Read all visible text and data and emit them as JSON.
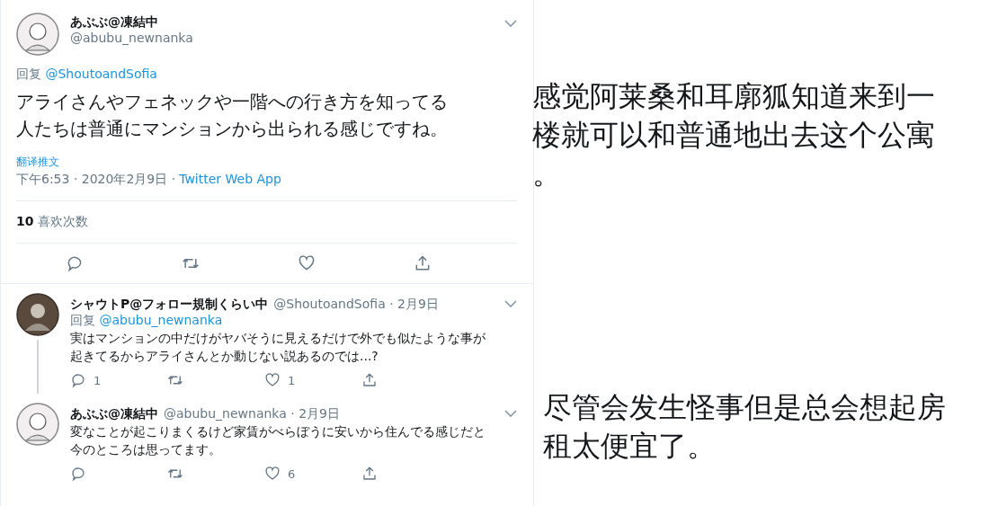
{
  "tweet": {
    "name": "あぶぶ@凍結中",
    "handle": "@abubu_newnanka",
    "reply_label": "回复",
    "reply_handle": "@ShoutoandSofia",
    "text": "アライさんやフェネックや一階への行き方を知ってる人たちは普通にマンションから出られる感じですね。",
    "translate": "翻译推文",
    "timestamp": "下午6:53 · 2020年2月9日 ·",
    "source": "Twitter Web App",
    "like_count": "10",
    "like_label": "喜欢次数"
  },
  "replies": [
    {
      "name": "シャウトP@フォロー規制くらい中",
      "meta": "@ShoutoandSofia · 2月9日",
      "reply_label": "回复",
      "reply_handle": "@abubu_newnanka",
      "text": "実はマンションの中だけがヤバそうに見えるだけで外でも似たような事が起きてるからアライさんとか動じない説あるのでは...?",
      "reply_count": "1",
      "like_count": "1",
      "thread_line": true
    },
    {
      "name": "あぶぶ@凍結中",
      "meta": "@abubu_newnanka · 2月9日",
      "text": "変なことが起こりまくるけど家賃がべらぼうに安いから住んでる感じだと今のところは思ってます。",
      "like_count": "6",
      "thread_line": false
    }
  ],
  "captions": [
    "感觉阿莱桑和耳廓狐知道来到一楼就可以和普通地出去这个公寓。",
    "尽管会发生怪事但是总会想起房租太便宜了。"
  ]
}
